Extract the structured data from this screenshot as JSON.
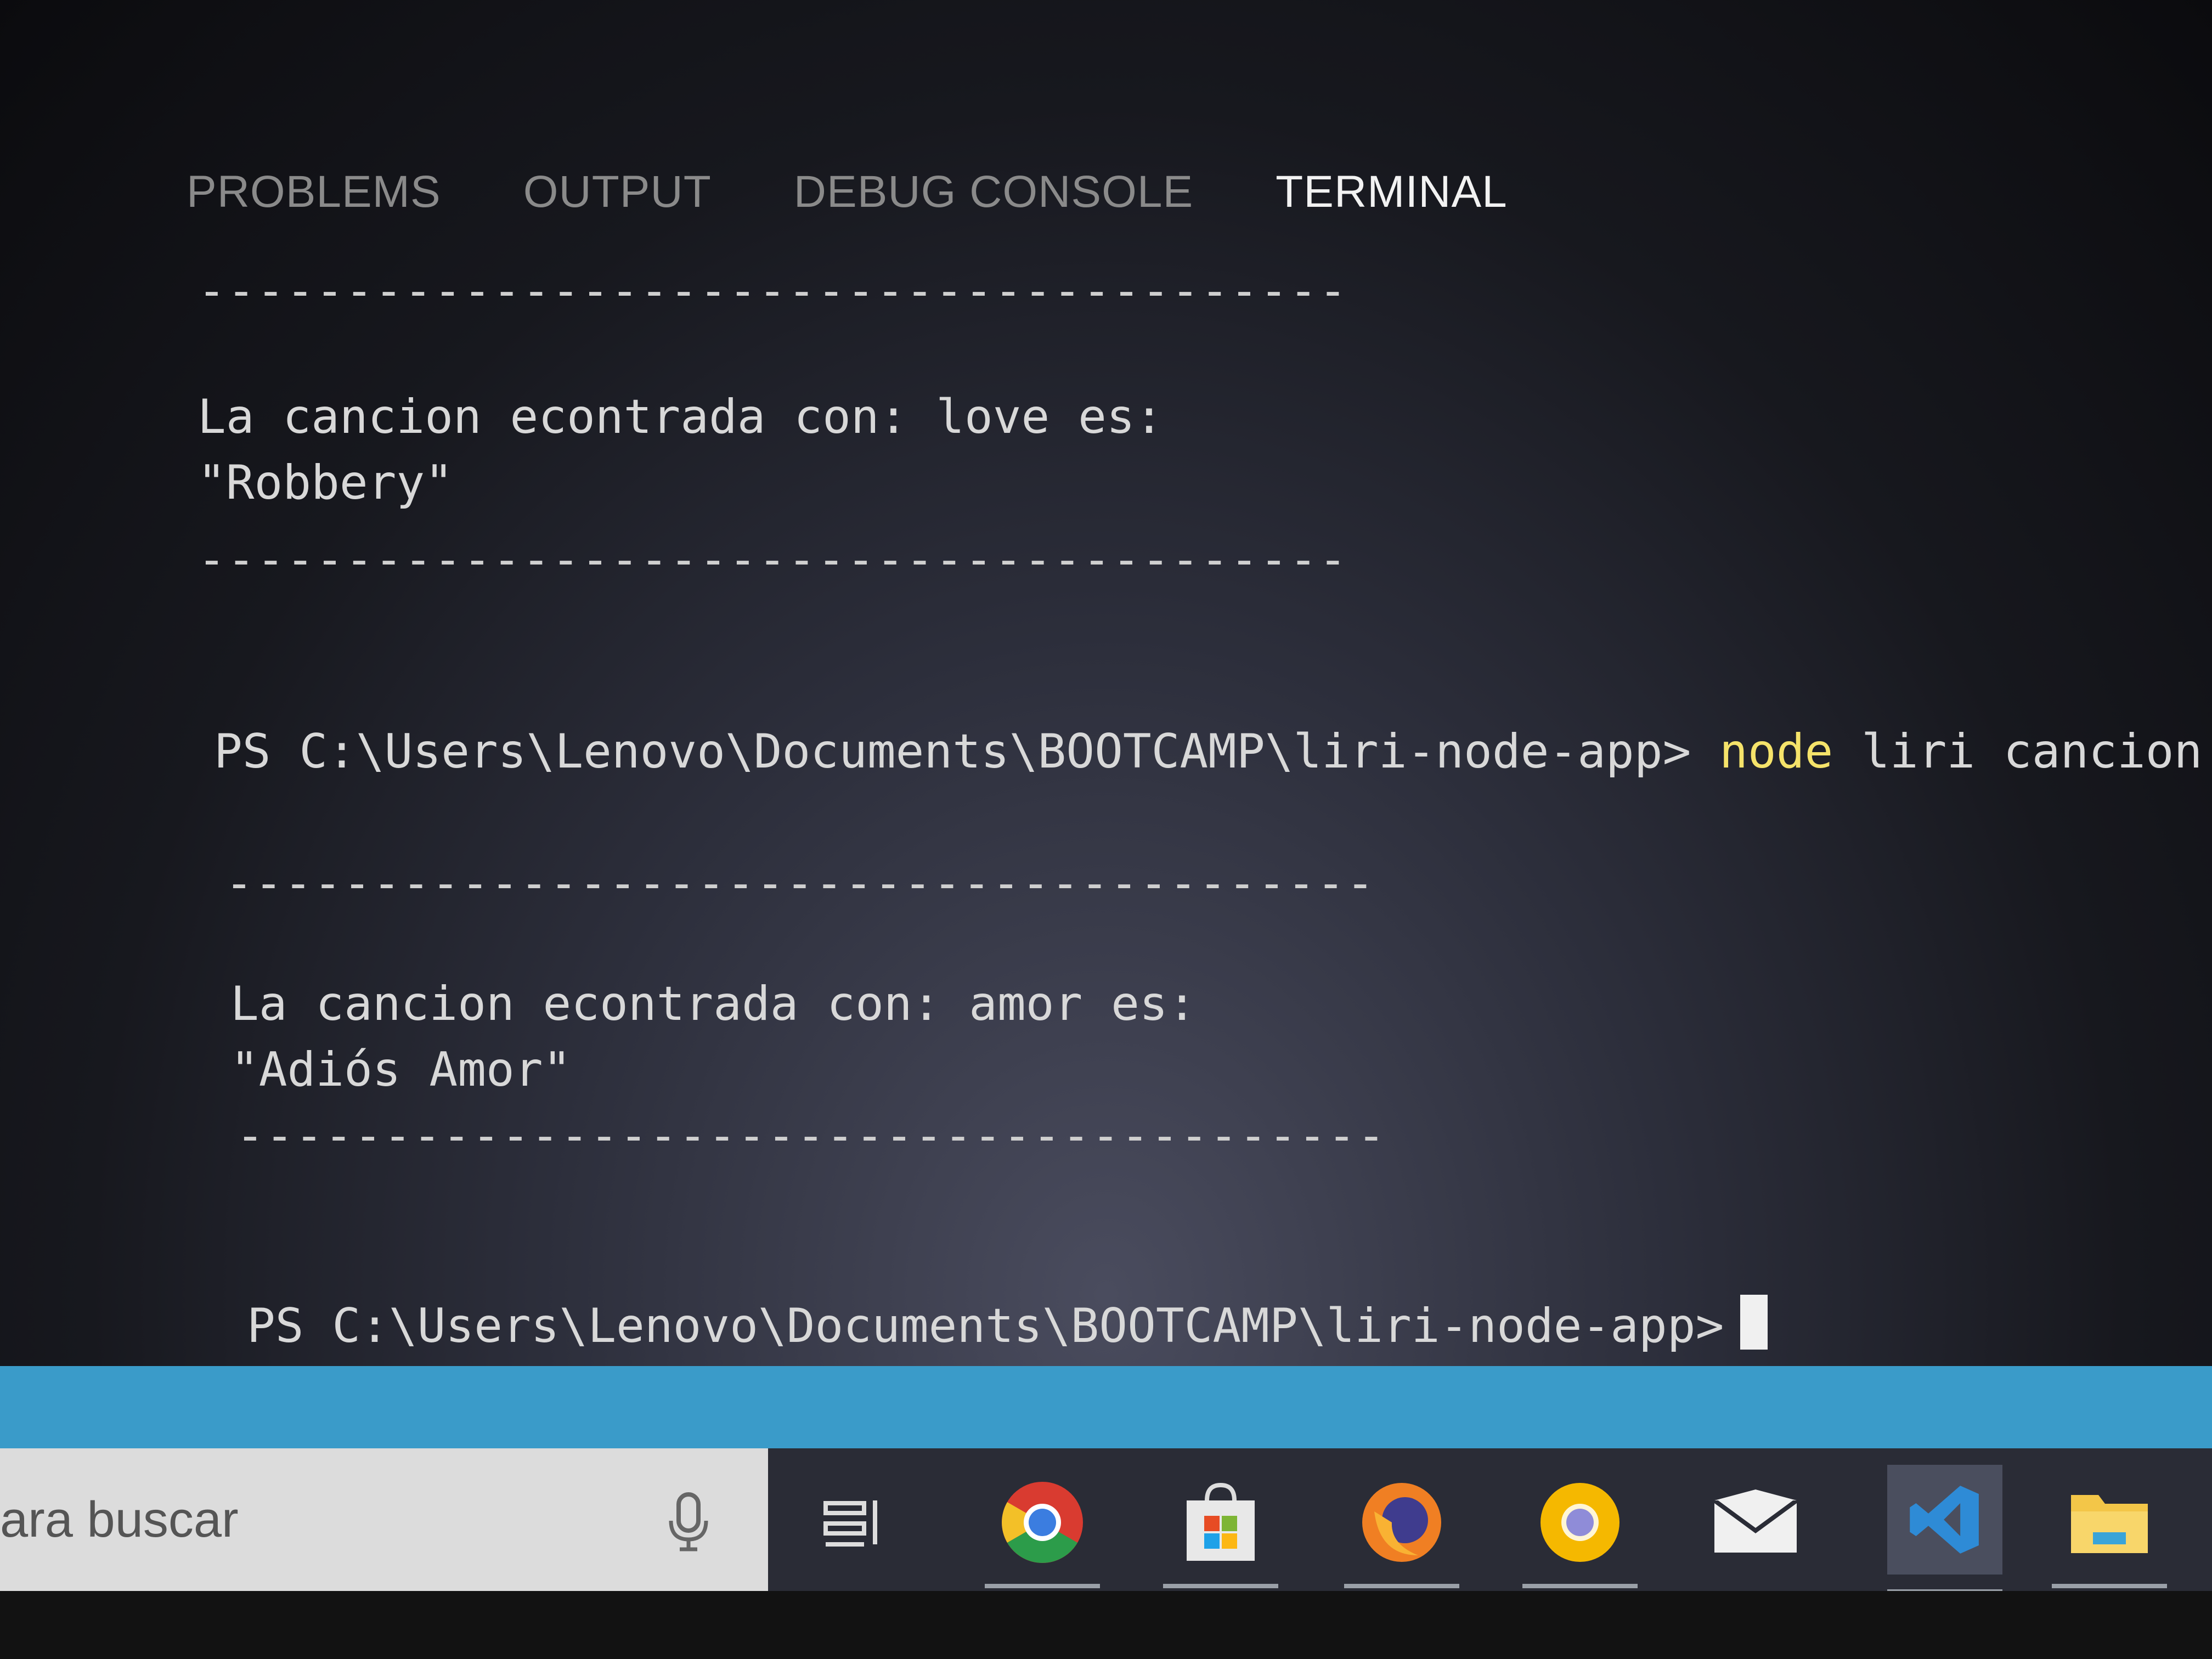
{
  "panel": {
    "tabs": [
      {
        "label": "PROBLEMS",
        "active": false
      },
      {
        "label": "OUTPUT",
        "active": false
      },
      {
        "label": "DEBUG CONSOLE",
        "active": false
      },
      {
        "label": "TERMINAL",
        "active": true
      }
    ]
  },
  "terminal": {
    "separator": "---------------------------------------",
    "lines": {
      "result1_line1": "La cancion econtrada con: love es:",
      "result1_line2": "\"Robbery\"",
      "prompt1": "PS C:\\Users\\Lenovo\\Documents\\BOOTCAMP\\liri-node-app>",
      "command1_node": "node",
      "command1_rest": "liri cancion amo",
      "result2_line1": "La cancion econtrada con: amor es:",
      "result2_line2": "\"Adiós Amor\"",
      "prompt2": "PS C:\\Users\\Lenovo\\Documents\\BOOTCAMP\\liri-node-app>"
    }
  },
  "taskbar": {
    "search_text": "ara buscar",
    "icons": [
      "task-view-icon",
      "chrome-icon",
      "store-icon",
      "firefox-icon",
      "chrome-canary-icon",
      "mail-icon",
      "vscode-icon",
      "file-explorer-icon"
    ]
  },
  "colors": {
    "statusbar": "#3a9bc9",
    "command_highlight": "#f5e36a",
    "taskbar": "#2a2c36"
  }
}
